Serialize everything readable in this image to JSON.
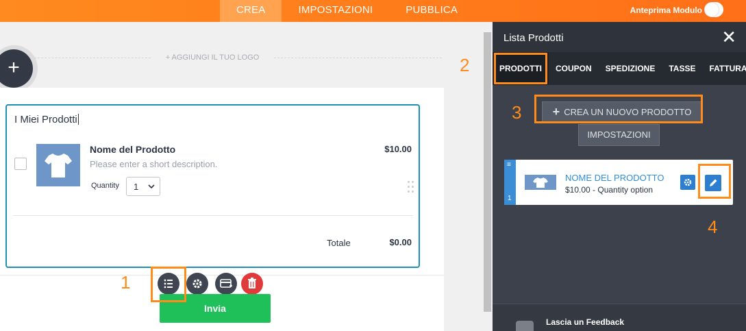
{
  "topbar": {
    "tabs": [
      {
        "label": "CREA",
        "active": true
      },
      {
        "label": "IMPOSTAZIONI",
        "active": false
      },
      {
        "label": "PUBBLICA",
        "active": false
      }
    ],
    "preview_label": "Anteprima Modulo",
    "preview_on": false
  },
  "canvas": {
    "add_logo_label": "+ AGGIUNGI IL TUO LOGO",
    "add_button_label": "+"
  },
  "product_widget": {
    "title": "I Miei Prodotti",
    "product": {
      "name": "Nome del Prodotto",
      "description": "Please enter a short description.",
      "price": "$10.00",
      "quantity_label": "Quantity",
      "quantity_value": "1"
    },
    "total_label": "Totale",
    "total_value": "$0.00"
  },
  "submit_label": "Invia",
  "panel": {
    "title": "Lista Prodotti",
    "close_label": "✕",
    "tabs": [
      {
        "label": "PRODOTTI",
        "active": true
      },
      {
        "label": "COUPON",
        "active": false
      },
      {
        "label": "SPEDIZIONE",
        "active": false
      },
      {
        "label": "TASSE",
        "active": false
      },
      {
        "label": "FATTURA",
        "active": false
      }
    ],
    "create_button_label": "CREA UN NUOVO PRODOTTO",
    "settings_button_label": "IMPOSTAZIONI",
    "product_card": {
      "index": "1",
      "name": "NOME DEL PRODOTTO",
      "subtitle": "$10.00 - Quantity option"
    },
    "feedback_label": "Lascia un Feedback"
  },
  "callouts": [
    "1",
    "2",
    "3",
    "4"
  ],
  "colors": {
    "accent": "#ff8c1a",
    "topbar": "#ff7a1a",
    "panel": "#3c414b",
    "submit": "#1fbf5a",
    "link_blue": "#2f8ed6",
    "delete_red": "#e03a3a"
  }
}
